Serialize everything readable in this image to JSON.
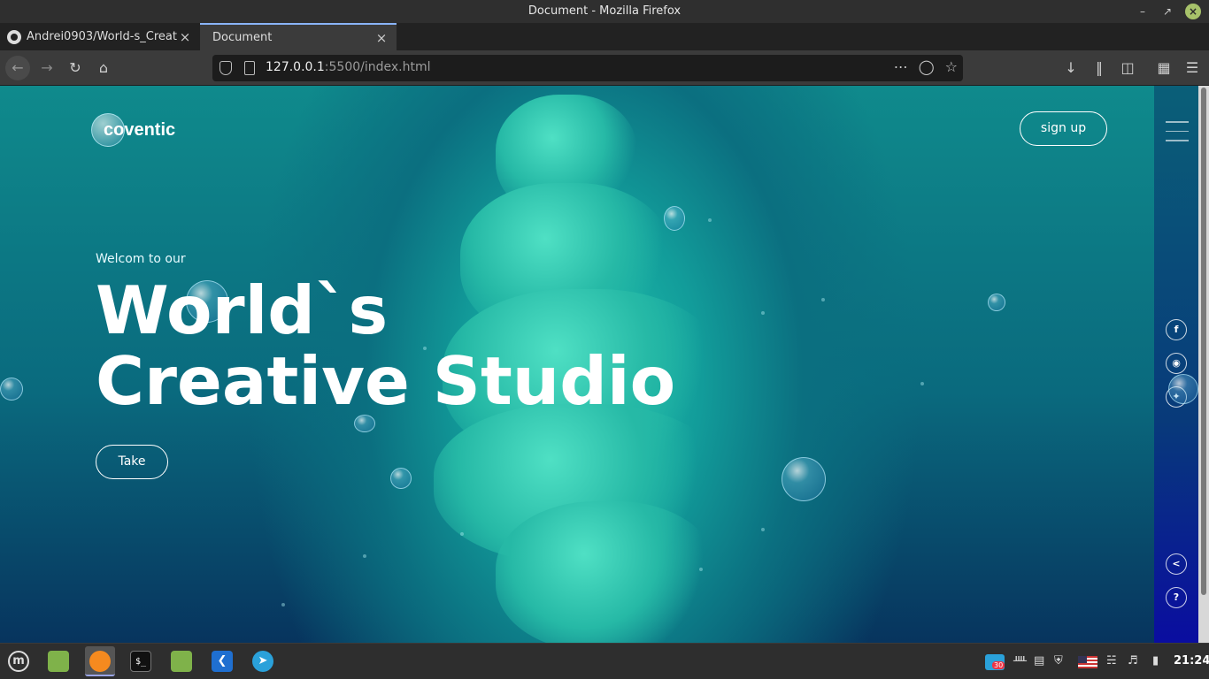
{
  "window": {
    "title": "Document - Mozilla Firefox"
  },
  "tabs": [
    {
      "label": "Andrei0903/World-s_Creat",
      "icon": "github-icon",
      "active": false
    },
    {
      "label": "Document",
      "icon": "",
      "active": true
    }
  ],
  "navbar": {
    "url_host": "127.0.0.1",
    "url_path": ":5500/index.html"
  },
  "page": {
    "logo_text": "coventic",
    "signup_label": "sign up",
    "welcome": "Welcom to our",
    "headline_line1": "World`s",
    "headline_line2": "Creative Studio",
    "cta_label": "Take",
    "social": {
      "facebook": "f",
      "share": "<",
      "help": "?"
    },
    "colors": {
      "ink": "#26b9a6",
      "background_top": "#0f8a8c",
      "background_bottom": "#07345e"
    }
  },
  "taskbar": {
    "apps": [
      "mint-menu-icon",
      "files-icon",
      "firefox-icon",
      "terminal-icon",
      "files-icon",
      "vscode-icon",
      "telegram-icon"
    ],
    "terminal_glyph": "$_",
    "telegram_badge": "30",
    "clock": "21:24"
  }
}
